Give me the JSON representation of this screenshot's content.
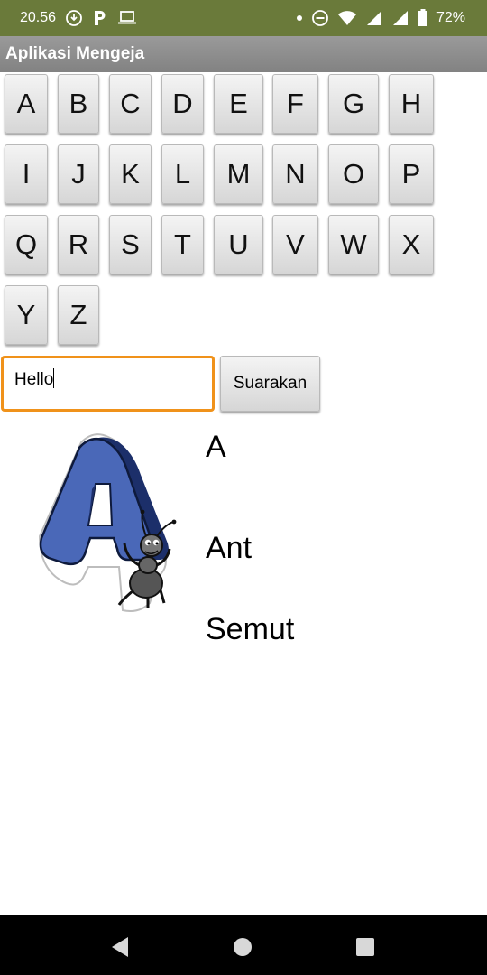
{
  "status_bar": {
    "time": "20.56",
    "battery": "72%",
    "icons": [
      "download-icon",
      "parking-icon",
      "laptop-icon",
      "dot-icon",
      "do-not-disturb-icon",
      "wifi-icon",
      "signal-icon",
      "signal-icon",
      "battery-icon"
    ]
  },
  "app": {
    "title": "Aplikasi Mengeja"
  },
  "keys": [
    "A",
    "B",
    "C",
    "D",
    "E",
    "F",
    "G",
    "H",
    "I",
    "J",
    "K",
    "L",
    "M",
    "N",
    "O",
    "P",
    "Q",
    "R",
    "S",
    "T",
    "U",
    "V",
    "W",
    "X",
    "Y",
    "Z"
  ],
  "input": {
    "value": "Hello"
  },
  "speak_button": {
    "label": "Suarakan"
  },
  "display": {
    "letter": "A",
    "word_en": "Ant",
    "word_id": "Semut",
    "image": "letter-a-ant-illustration"
  },
  "nav": {
    "icons": [
      "back-icon",
      "home-icon",
      "recents-icon"
    ]
  }
}
